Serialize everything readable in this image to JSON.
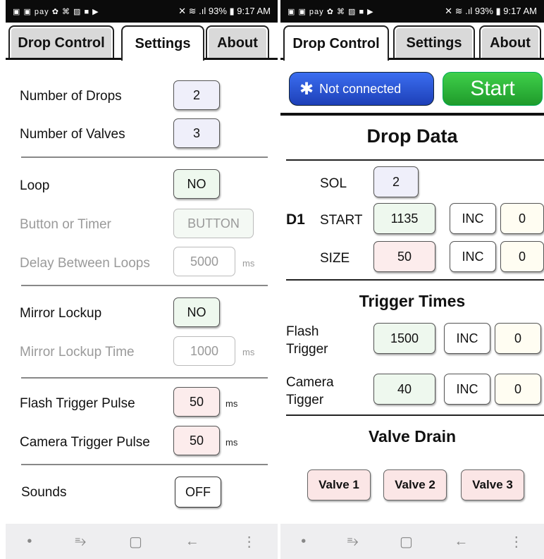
{
  "status": {
    "left_icons": "▣ ▣ pay ✿ ⌘ ▨ ■ ▶",
    "right": "✕ ≋ .ıl 93% ▮ 9:17 AM"
  },
  "tabs": {
    "drop_control": "Drop Control",
    "settings": "Settings",
    "about": "About"
  },
  "settings": {
    "num_drops_label": "Number of Drops",
    "num_drops_value": "2",
    "num_valves_label": "Number of Valves",
    "num_valves_value": "3",
    "loop_label": "Loop",
    "loop_value": "NO",
    "button_timer_label": "Button or Timer",
    "button_timer_value": "BUTTON",
    "delay_label": "Delay Between Loops",
    "delay_value": "5000",
    "delay_unit": "ms",
    "mirror_label": "Mirror Lockup",
    "mirror_value": "NO",
    "mirror_time_label": "Mirror Lockup Time",
    "mirror_time_value": "1000",
    "mirror_time_unit": "ms",
    "flash_pulse_label": "Flash Trigger Pulse",
    "flash_pulse_value": "50",
    "flash_pulse_unit": "ms",
    "camera_pulse_label": "Camera Trigger Pulse",
    "camera_pulse_value": "50",
    "camera_pulse_unit": "ms",
    "sounds_label": "Sounds",
    "sounds_value": "OFF"
  },
  "drop_control": {
    "bt_label": "Not connected",
    "start_label": "Start",
    "drop_data_title": "Drop Data",
    "d1_label": "D1",
    "sol_label": "SOL",
    "sol_value": "2",
    "start_row_label": "START",
    "start_value": "1135",
    "start_inc": "INC",
    "start_inc_value": "0",
    "size_label": "SIZE",
    "size_value": "50",
    "size_inc": "INC",
    "size_inc_value": "0",
    "trigger_title": "Trigger Times",
    "flash_label_1": "Flash",
    "flash_label_2": "Trigger",
    "flash_value": "1500",
    "flash_inc": "INC",
    "flash_inc_value": "0",
    "camera_label_1": "Camera",
    "camera_label_2": "Tigger",
    "camera_value": "40",
    "camera_inc": "INC",
    "camera_inc_value": "0",
    "valve_title": "Valve Drain",
    "valve1": "Valve 1",
    "valve2": "Valve 2",
    "valve3": "Valve 3"
  },
  "navbar": {
    "dot": "•",
    "recents": "⥱",
    "home": "▢",
    "back": "←",
    "menu": "⋮"
  }
}
